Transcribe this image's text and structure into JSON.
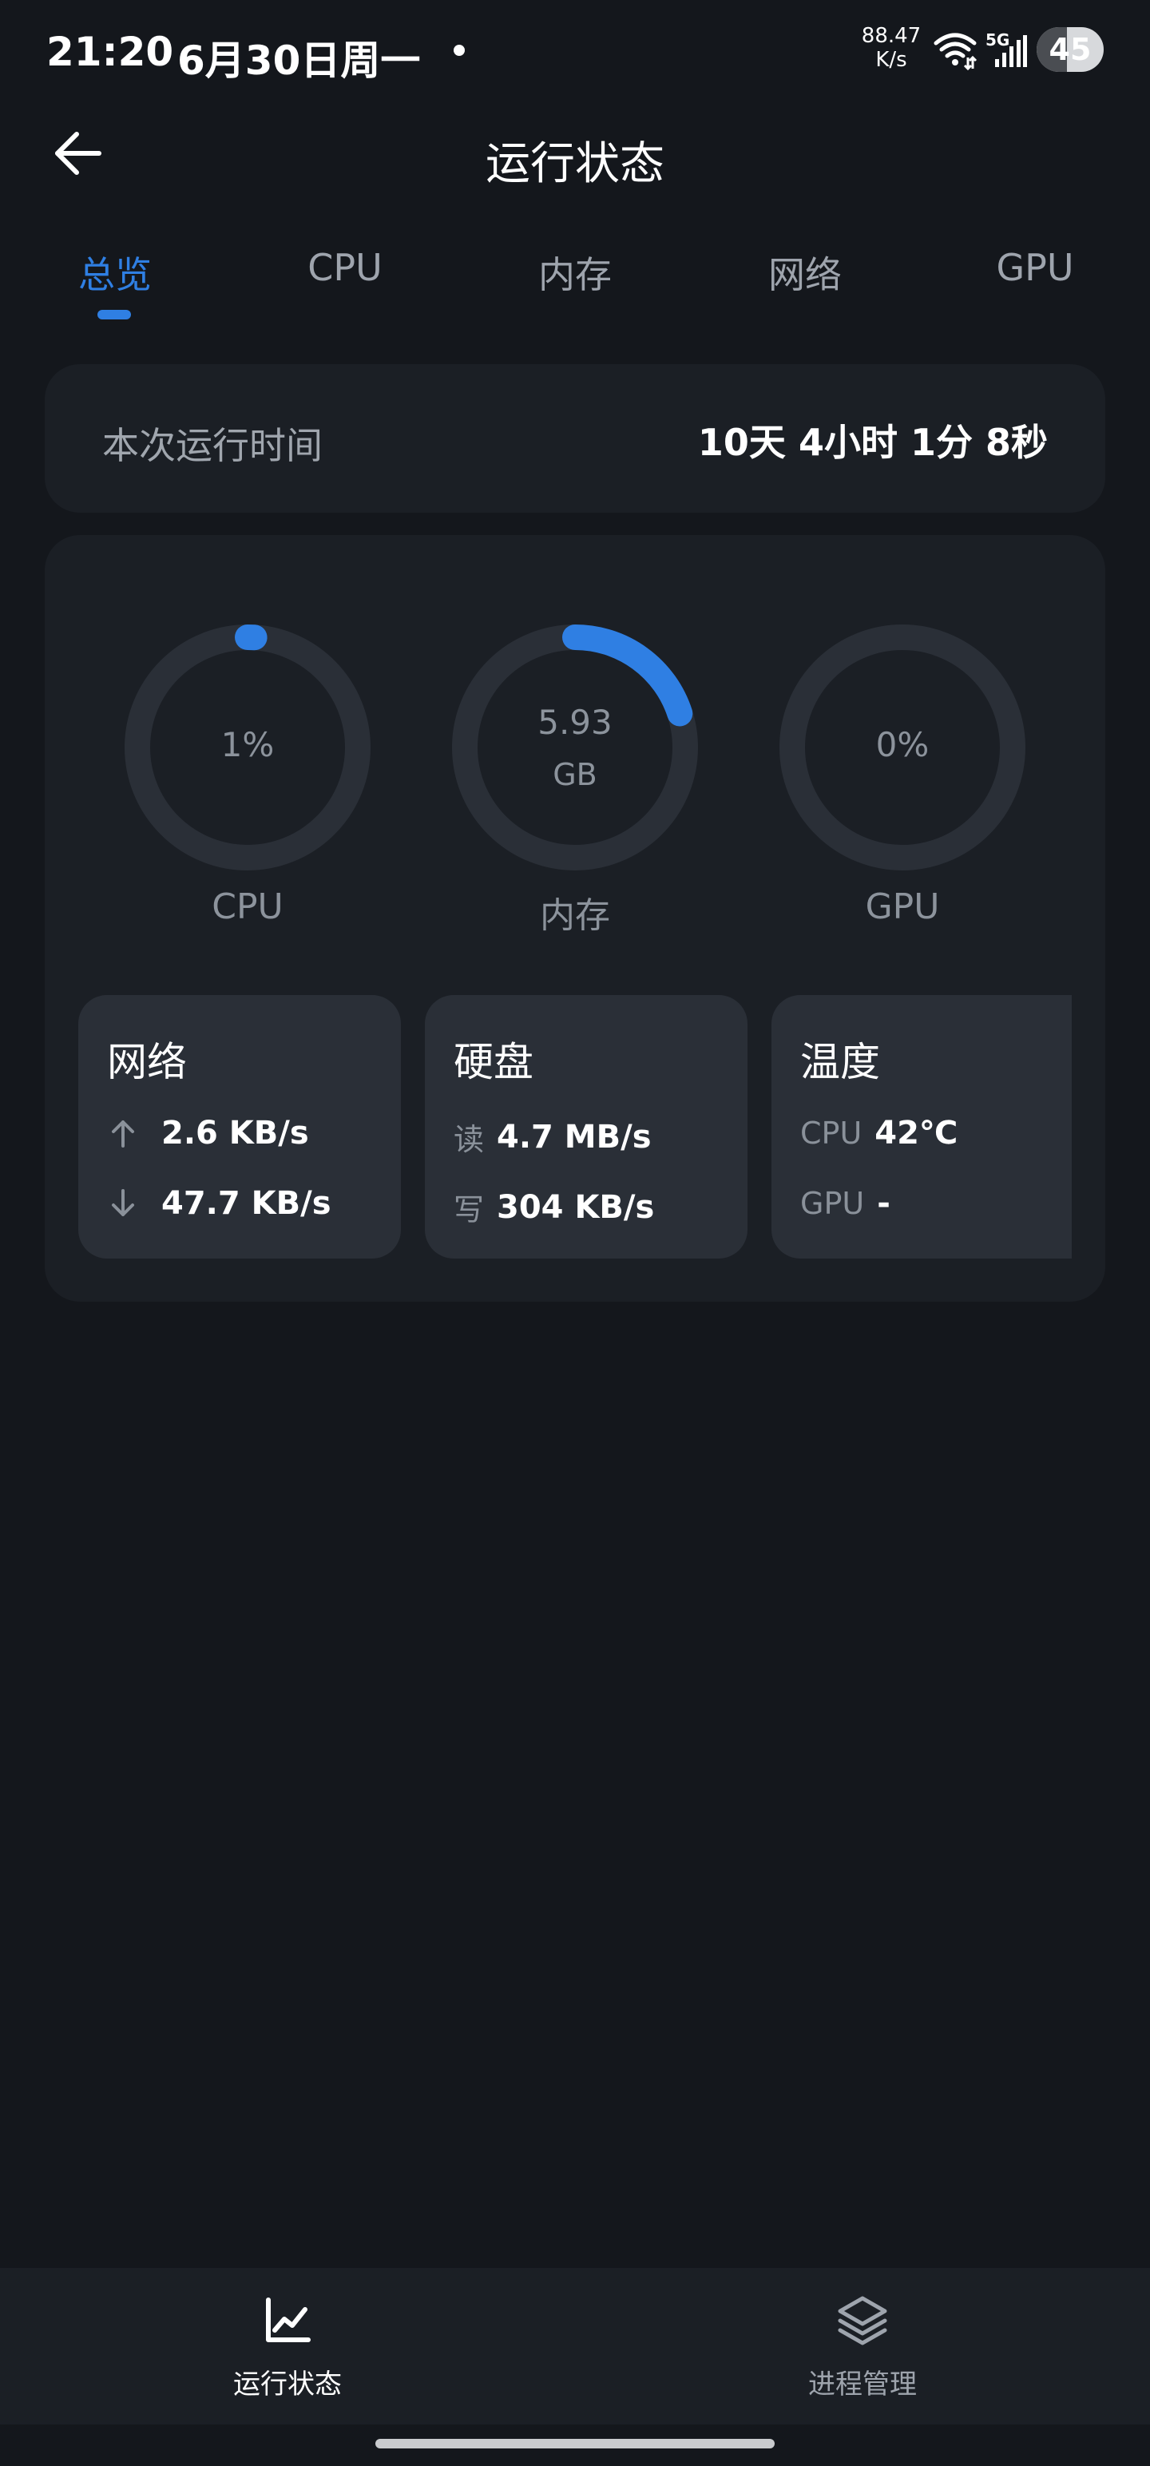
{
  "status_bar": {
    "time": "21:20",
    "date": "6月30日周一",
    "net_speed_value": "88.47",
    "net_speed_unit": "K/s",
    "network_type": "5G",
    "battery_percent": 45,
    "battery_label": "45"
  },
  "header": {
    "title": "运行状态",
    "back_icon": "arrow-left-icon"
  },
  "tabs": [
    {
      "label": "总览",
      "active": true
    },
    {
      "label": "CPU",
      "active": false
    },
    {
      "label": "内存",
      "active": false
    },
    {
      "label": "网络",
      "active": false
    },
    {
      "label": "GPU",
      "active": false
    }
  ],
  "uptime": {
    "label": "本次运行时间",
    "value": "10天 4小时 1分 8秒"
  },
  "gauges": [
    {
      "name": "CPU",
      "value_text": "1%",
      "unit_text": "",
      "fill_fraction": 0.01
    },
    {
      "name": "内存",
      "value_text": "5.93",
      "unit_text": "GB",
      "fill_fraction": 0.2
    },
    {
      "name": "GPU",
      "value_text": "0%",
      "unit_text": "",
      "fill_fraction": 0.0
    }
  ],
  "network": {
    "title": "网络",
    "upload": "2.6 KB/s",
    "download": "47.7 KB/s",
    "upload_icon": "arrow-up-icon",
    "download_icon": "arrow-down-icon"
  },
  "disk": {
    "title": "硬盘",
    "read_label": "读",
    "read_value": "4.7 MB/s",
    "write_label": "写",
    "write_value": "304 KB/s"
  },
  "temperature": {
    "title": "温度",
    "cpu_label": "CPU",
    "cpu_value": "42℃",
    "gpu_label": "GPU",
    "gpu_value": "-"
  },
  "bottom_nav": [
    {
      "label": "运行状态",
      "icon": "line-chart-icon",
      "active": true
    },
    {
      "label": "进程管理",
      "icon": "layers-icon",
      "active": false
    }
  ],
  "colors": {
    "background": "#14171c",
    "card": "#1b1f25",
    "stat_card": "#2a2f37",
    "accent": "#2f7fe3",
    "gauge_track": "#2a2f37",
    "muted_text": "#8c939c"
  }
}
